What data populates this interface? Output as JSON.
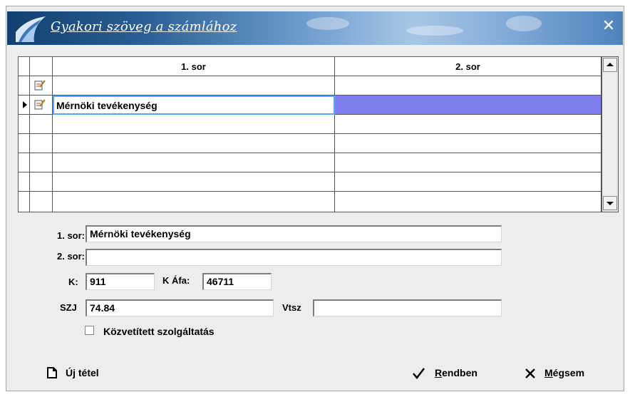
{
  "window": {
    "title": "Gyakori szöveg a számlához",
    "close_glyph": "✕",
    "title_bg": "#2a5e94"
  },
  "grid": {
    "columns": [
      "1. sor",
      "2. sor"
    ],
    "rows": [
      {
        "sor1": "",
        "sor2": "",
        "icon": "edit-record-icon",
        "current": false
      },
      {
        "sor1": "Mérnöki tevékenység",
        "sor2": "",
        "icon": "edit-record-icon",
        "current": true
      }
    ],
    "highlight_color": "#7f7ff0",
    "focus_color": "#55a8f5"
  },
  "form": {
    "sor1_label": "1. sor:",
    "sor1_value": "Mérnöki tevékenység",
    "sor2_label": "2. sor:",
    "sor2_value": "",
    "k_label": "K:",
    "k_value": "911",
    "kafa_label": "K Áfa:",
    "kafa_value": "46711",
    "szj_label": "SZJ",
    "szj_value": "74.84",
    "vtsz_label": "Vtsz",
    "vtsz_value": "",
    "checkbox_label": "Közvetített szolgáltatás",
    "checkbox_checked": false
  },
  "buttons": {
    "new_item": "Új tétel",
    "ok": "Rendben",
    "cancel": "Mégsem"
  }
}
